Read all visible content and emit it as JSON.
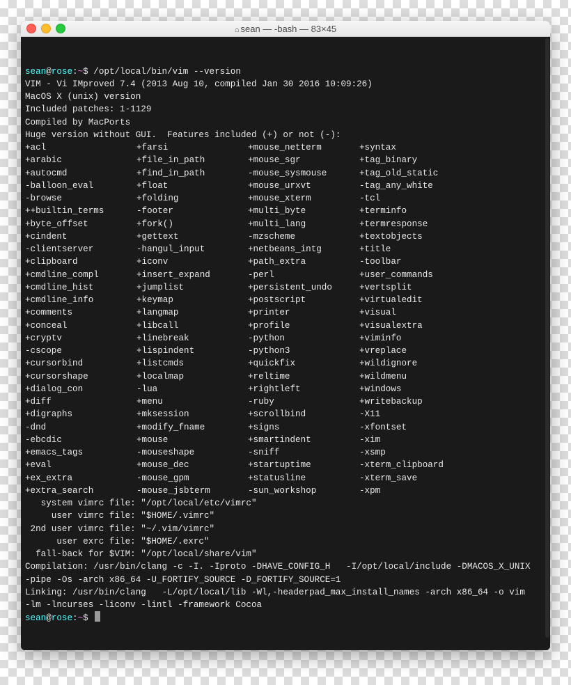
{
  "window": {
    "title": "sean — -bash — 83×45",
    "home_icon": "⌂"
  },
  "prompt": {
    "user": "sean",
    "host": "rose",
    "path": "~",
    "symbol": "$",
    "command1": "/opt/local/bin/vim --version"
  },
  "header_lines": [
    "VIM - Vi IMproved 7.4 (2013 Aug 10, compiled Jan 30 2016 10:09:26)",
    "MacOS X (unix) version",
    "Included patches: 1-1129",
    "Compiled by MacPorts",
    "Huge version without GUI.  Features included (+) or not (-):"
  ],
  "features": [
    [
      "+acl",
      "+farsi",
      "+mouse_netterm",
      "+syntax"
    ],
    [
      "+arabic",
      "+file_in_path",
      "+mouse_sgr",
      "+tag_binary"
    ],
    [
      "+autocmd",
      "+find_in_path",
      "-mouse_sysmouse",
      "+tag_old_static"
    ],
    [
      "-balloon_eval",
      "+float",
      "+mouse_urxvt",
      "-tag_any_white"
    ],
    [
      "-browse",
      "+folding",
      "+mouse_xterm",
      "-tcl"
    ],
    [
      "++builtin_terms",
      "-footer",
      "+multi_byte",
      "+terminfo"
    ],
    [
      "+byte_offset",
      "+fork()",
      "+multi_lang",
      "+termresponse"
    ],
    [
      "+cindent",
      "+gettext",
      "-mzscheme",
      "+textobjects"
    ],
    [
      "-clientserver",
      "-hangul_input",
      "+netbeans_intg",
      "+title"
    ],
    [
      "+clipboard",
      "+iconv",
      "+path_extra",
      "-toolbar"
    ],
    [
      "+cmdline_compl",
      "+insert_expand",
      "-perl",
      "+user_commands"
    ],
    [
      "+cmdline_hist",
      "+jumplist",
      "+persistent_undo",
      "+vertsplit"
    ],
    [
      "+cmdline_info",
      "+keymap",
      "+postscript",
      "+virtualedit"
    ],
    [
      "+comments",
      "+langmap",
      "+printer",
      "+visual"
    ],
    [
      "+conceal",
      "+libcall",
      "+profile",
      "+visualextra"
    ],
    [
      "+cryptv",
      "+linebreak",
      "-python",
      "+viminfo"
    ],
    [
      "-cscope",
      "+lispindent",
      "-python3",
      "+vreplace"
    ],
    [
      "+cursorbind",
      "+listcmds",
      "+quickfix",
      "+wildignore"
    ],
    [
      "+cursorshape",
      "+localmap",
      "+reltime",
      "+wildmenu"
    ],
    [
      "+dialog_con",
      "-lua",
      "+rightleft",
      "+windows"
    ],
    [
      "+diff",
      "+menu",
      "-ruby",
      "+writebackup"
    ],
    [
      "+digraphs",
      "+mksession",
      "+scrollbind",
      "-X11"
    ],
    [
      "-dnd",
      "+modify_fname",
      "+signs",
      "-xfontset"
    ],
    [
      "-ebcdic",
      "+mouse",
      "+smartindent",
      "-xim"
    ],
    [
      "+emacs_tags",
      "-mouseshape",
      "-sniff",
      "-xsmp"
    ],
    [
      "+eval",
      "+mouse_dec",
      "+startuptime",
      "-xterm_clipboard"
    ],
    [
      "+ex_extra",
      "-mouse_gpm",
      "+statusline",
      "-xterm_save"
    ],
    [
      "+extra_search",
      "-mouse_jsbterm",
      "-sun_workshop",
      "-xpm"
    ]
  ],
  "config_lines": [
    "   system vimrc file: \"/opt/local/etc/vimrc\"",
    "     user vimrc file: \"$HOME/.vimrc\"",
    " 2nd user vimrc file: \"~/.vim/vimrc\"",
    "      user exrc file: \"$HOME/.exrc\"",
    "  fall-back for $VIM: \"/opt/local/share/vim\""
  ],
  "compile_lines": [
    "Compilation: /usr/bin/clang -c -I. -Iproto -DHAVE_CONFIG_H   -I/opt/local/include -DMACOS_X_UNIX  -pipe -Os -arch x86_64 -U_FORTIFY_SOURCE -D_FORTIFY_SOURCE=1      ",
    "Linking: /usr/bin/clang   -L/opt/local/lib -Wl,-headerpad_max_install_names -arch x86_64 -o vim        -lm -lncurses -liconv -lintl -framework Cocoa           "
  ]
}
